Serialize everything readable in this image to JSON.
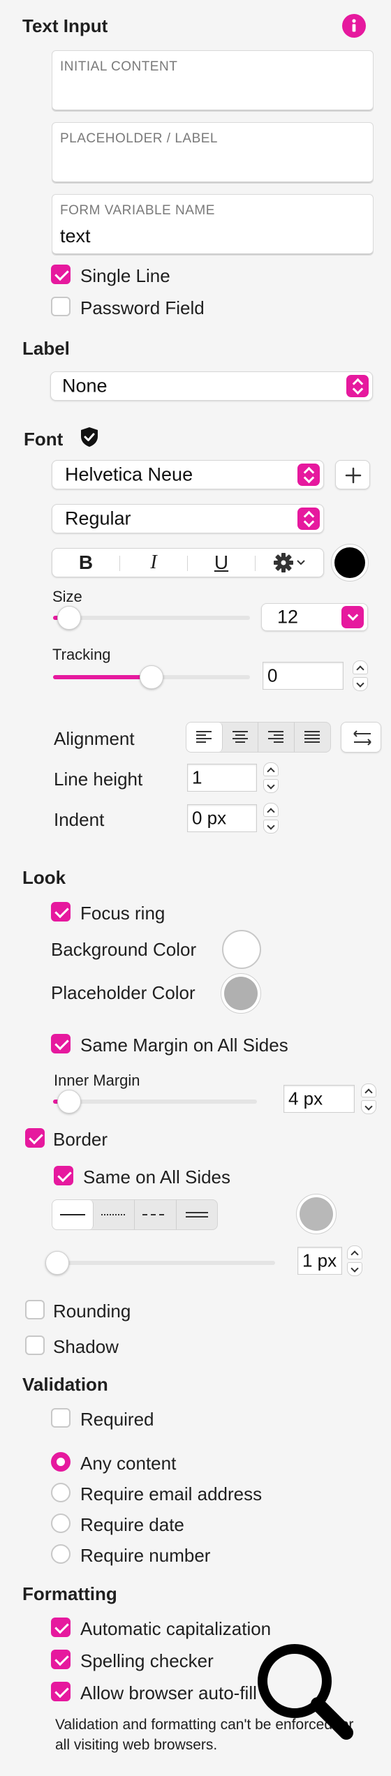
{
  "text_input": {
    "title": "Text Input",
    "info_icon": "info-icon",
    "fields": [
      {
        "caption": "INITIAL CONTENT",
        "value": ""
      },
      {
        "caption": "PLACEHOLDER / LABEL",
        "value": ""
      },
      {
        "caption": "FORM VARIABLE NAME",
        "value": "text"
      }
    ],
    "single_line": {
      "label": "Single Line",
      "checked": true
    },
    "password_field": {
      "label": "Password Field",
      "checked": false
    }
  },
  "label_section": {
    "title": "Label",
    "selected": "None"
  },
  "font": {
    "title": "Font",
    "family": "Helvetica Neue",
    "weight": "Regular",
    "style_buttons": {
      "bold": "B",
      "italic": "I",
      "underline": "U"
    },
    "color": "#000000",
    "size_label": "Size",
    "size_value": "12",
    "size_level": 0.08,
    "tracking_label": "Tracking",
    "tracking_value": "0",
    "tracking_level": 0.5,
    "alignment_label": "Alignment",
    "alignment_selected": "left",
    "line_height_label": "Line height",
    "line_height_value": "1",
    "indent_label": "Indent",
    "indent_value": "0 px"
  },
  "look": {
    "title": "Look",
    "focus_ring": {
      "label": "Focus ring",
      "checked": true
    },
    "background_color_label": "Background Color",
    "background_color": "#ffffff",
    "placeholder_color_label": "Placeholder Color",
    "placeholder_color": "#b0b0b0",
    "same_margin": {
      "label": "Same Margin on All Sides",
      "checked": true
    },
    "inner_margin_label": "Inner Margin",
    "inner_margin_value": "4 px",
    "inner_margin_level": 0.08,
    "border": {
      "label": "Border",
      "checked": true
    },
    "same_on_all_sides": {
      "label": "Same on All Sides",
      "checked": true
    },
    "border_color": "#b8b8b8",
    "border_width_value": "1 px",
    "border_width_level": 0.02,
    "rounding": {
      "label": "Rounding",
      "checked": false
    },
    "shadow": {
      "label": "Shadow",
      "checked": false
    }
  },
  "validation": {
    "title": "Validation",
    "required": {
      "label": "Required",
      "checked": false
    },
    "options": [
      {
        "label": "Any content",
        "selected": true
      },
      {
        "label": "Require email address",
        "selected": false
      },
      {
        "label": "Require date",
        "selected": false
      },
      {
        "label": "Require number",
        "selected": false
      }
    ]
  },
  "formatting": {
    "title": "Formatting",
    "automatic_capitalization": {
      "label": "Automatic capitalization",
      "checked": true
    },
    "spelling_checker": {
      "label": "Spelling checker",
      "checked": true
    },
    "browser_autofill": {
      "label": "Allow browser auto-fill",
      "checked": true
    },
    "note": "Validation and formatting can't be enforced for all visiting web browsers."
  },
  "accent_color": "#e6199e",
  "overlay_icon": "magnifier-icon"
}
